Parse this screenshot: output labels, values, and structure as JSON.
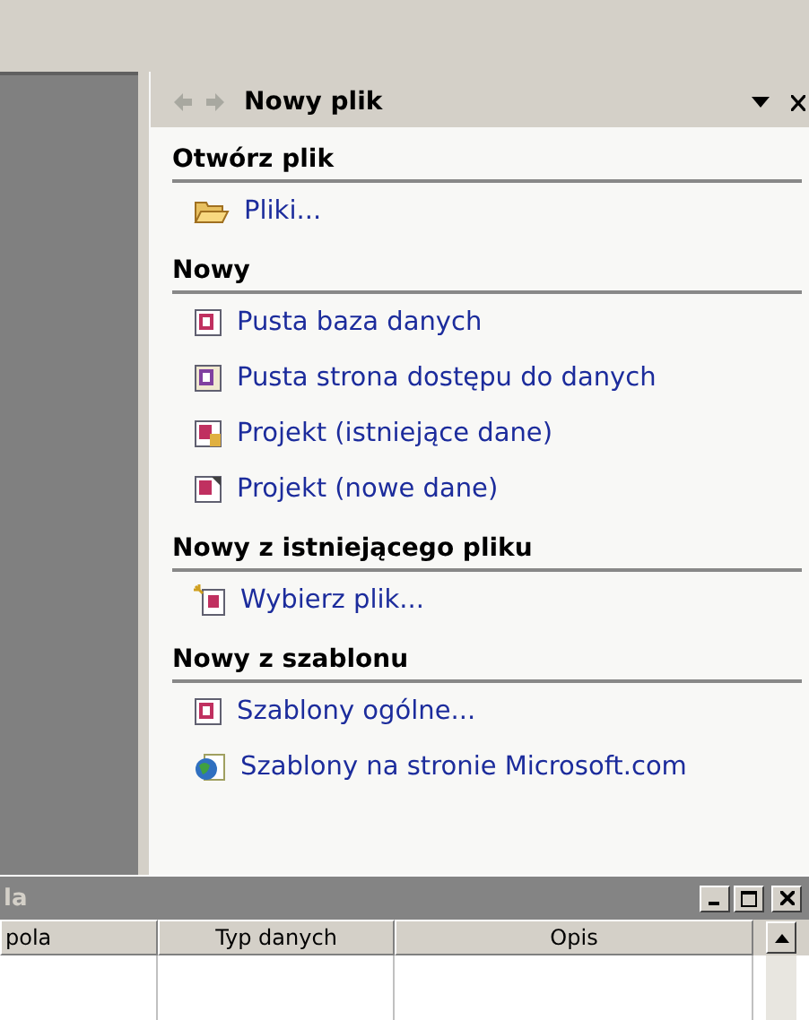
{
  "task_pane": {
    "title": "Nowy plik",
    "sections": [
      {
        "heading": "Otwórz plik",
        "items": [
          {
            "kind": "folder",
            "label": "Pliki..."
          }
        ]
      },
      {
        "heading": "Nowy",
        "items": [
          {
            "kind": "database",
            "label": "Pusta baza danych"
          },
          {
            "kind": "page",
            "label": "Pusta strona dostępu do danych"
          },
          {
            "kind": "project_existing",
            "label": "Projekt (istniejące dane)"
          },
          {
            "kind": "project_new",
            "label": "Projekt (nowe dane)"
          }
        ]
      },
      {
        "heading": "Nowy z istniejącego pliku",
        "items": [
          {
            "kind": "wizard",
            "label": "Wybierz plik..."
          }
        ]
      },
      {
        "heading": "Nowy z szablonu",
        "items": [
          {
            "kind": "database",
            "label": "Szablony ogólne..."
          },
          {
            "kind": "web",
            "label": "Szablony na stronie Microsoft.com"
          }
        ]
      }
    ]
  },
  "table_window": {
    "title": "la",
    "columns": [
      "pola",
      "Typ danych",
      "Opis"
    ]
  }
}
